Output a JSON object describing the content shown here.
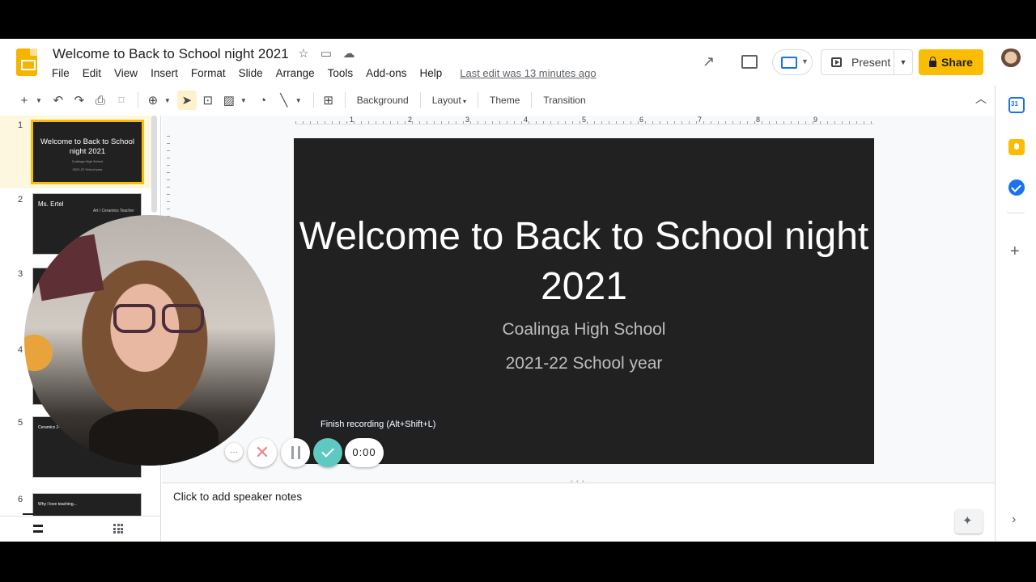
{
  "document": {
    "title": "Welcome to Back to School night 2021",
    "last_edit": "Last edit was 13 minutes ago"
  },
  "menubar": [
    "File",
    "Edit",
    "View",
    "Insert",
    "Format",
    "Slide",
    "Arrange",
    "Tools",
    "Add-ons",
    "Help"
  ],
  "header": {
    "present_label": "Present",
    "share_label": "Share"
  },
  "toolbar": {
    "background_label": "Background",
    "layout_label": "Layout",
    "theme_label": "Theme",
    "transition_label": "Transition"
  },
  "ruler": [
    "1",
    "2",
    "3",
    "4",
    "5",
    "6",
    "7",
    "8",
    "9"
  ],
  "filmstrip": [
    {
      "number": "1",
      "title": "Welcome to Back to School night 2021",
      "lines": [
        "Coalinga High School",
        "2021-22 School year"
      ]
    },
    {
      "number": "2",
      "title": "Ms. Ertel",
      "lines": [
        "Art / Ceramics Teacher"
      ]
    },
    {
      "number": "3"
    },
    {
      "number": "4"
    },
    {
      "number": "5",
      "title": "Ceramics 2-4"
    },
    {
      "number": "6",
      "title": "Why I love teaching..."
    }
  ],
  "slide": {
    "title": "Welcome to Back to School night 2021",
    "subtitle1": "Coalinga High School",
    "subtitle2": "2021-22 School year"
  },
  "speaker_notes_placeholder": "Click to add speaker notes",
  "recorder": {
    "tooltip": "Finish recording (Alt+Shift+L)",
    "timer": "0:00",
    "more_label": "···"
  },
  "side_panel": {
    "calendar_label": "31"
  },
  "colors": {
    "accent_yellow": "#fbbc04",
    "slide_bg": "#212121",
    "recorder_finish": "#5fc9c1"
  }
}
